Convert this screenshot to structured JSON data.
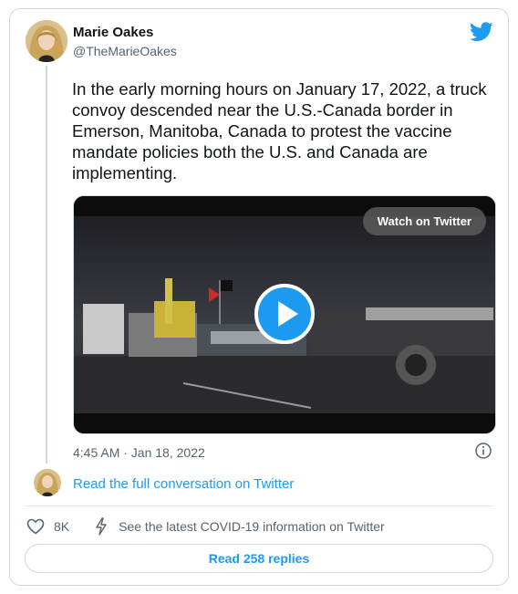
{
  "author": {
    "name": "Marie Oakes",
    "handle": "@TheMarieOakes"
  },
  "tweet": {
    "text": "In the early morning hours on January 17, 2022, a truck convoy descended near the U.S.-Canada border in Emerson, Manitoba, Canada to protest the vaccine mandate policies both the U.S. and Canada are implementing.",
    "timestamp": "4:45 AM · Jan 18, 2022"
  },
  "media": {
    "watch_label": "Watch on Twitter"
  },
  "thread": {
    "read_conversation": "Read the full conversation on Twitter"
  },
  "actions": {
    "like_count": "8K",
    "covid_info": "See the latest COVID-19 information on Twitter"
  },
  "replies_label": "Read 258 replies",
  "colors": {
    "accent": "#1d9bf0",
    "text": "#0f1419",
    "muted": "#536471",
    "border": "#cfd9de"
  },
  "icons": [
    "twitter-bird-icon",
    "play-icon",
    "info-icon",
    "heart-icon",
    "lightning-bolt-icon"
  ]
}
